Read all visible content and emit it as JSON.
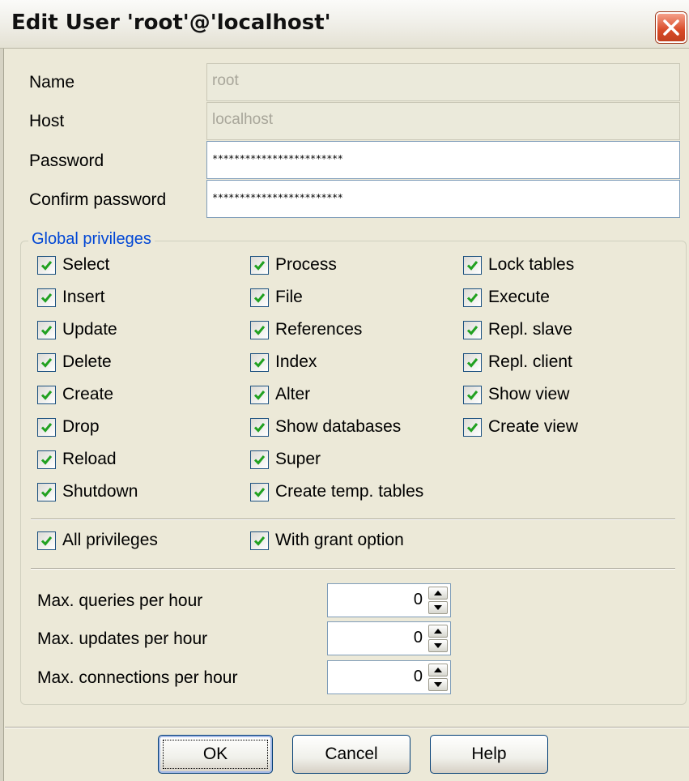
{
  "window": {
    "title": "Edit User 'root'@'localhost'"
  },
  "form": {
    "name_label": "Name",
    "name_value": "root",
    "host_label": "Host",
    "host_value": "localhost",
    "password_label": "Password",
    "password_value": "************************",
    "confirm_label": "Confirm password",
    "confirm_value": "************************"
  },
  "privileges": {
    "group_title": "Global privileges",
    "column1": [
      {
        "label": "Select",
        "checked": true
      },
      {
        "label": "Insert",
        "checked": true
      },
      {
        "label": "Update",
        "checked": true
      },
      {
        "label": "Delete",
        "checked": true
      },
      {
        "label": "Create",
        "checked": true
      },
      {
        "label": "Drop",
        "checked": true
      },
      {
        "label": "Reload",
        "checked": true
      },
      {
        "label": "Shutdown",
        "checked": true
      }
    ],
    "column2": [
      {
        "label": "Process",
        "checked": true
      },
      {
        "label": "File",
        "checked": true
      },
      {
        "label": "References",
        "checked": true
      },
      {
        "label": "Index",
        "checked": true
      },
      {
        "label": "Alter",
        "checked": true
      },
      {
        "label": "Show databases",
        "checked": true
      },
      {
        "label": "Super",
        "checked": true
      },
      {
        "label": "Create temp. tables",
        "checked": true
      }
    ],
    "column3": [
      {
        "label": "Lock tables",
        "checked": true
      },
      {
        "label": "Execute",
        "checked": true
      },
      {
        "label": "Repl. slave",
        "checked": true
      },
      {
        "label": "Repl. client",
        "checked": true
      },
      {
        "label": "Show view",
        "checked": true
      },
      {
        "label": "Create view",
        "checked": true
      }
    ],
    "all_privileges": {
      "label": "All privileges",
      "checked": true
    },
    "with_grant": {
      "label": "With grant option",
      "checked": true
    }
  },
  "limits": [
    {
      "label": "Max. queries per hour",
      "value": "0"
    },
    {
      "label": "Max. updates per hour",
      "value": "0"
    },
    {
      "label": "Max. connections per hour",
      "value": "0"
    }
  ],
  "buttons": {
    "ok": "OK",
    "cancel": "Cancel",
    "help": "Help"
  },
  "colors": {
    "accent": "#0046d5",
    "close": "#d84a27",
    "check": "#21a121"
  },
  "icons": {
    "close": "close-icon",
    "check": "check-icon",
    "spin_up": "arrow-up-icon",
    "spin_down": "arrow-down-icon"
  }
}
